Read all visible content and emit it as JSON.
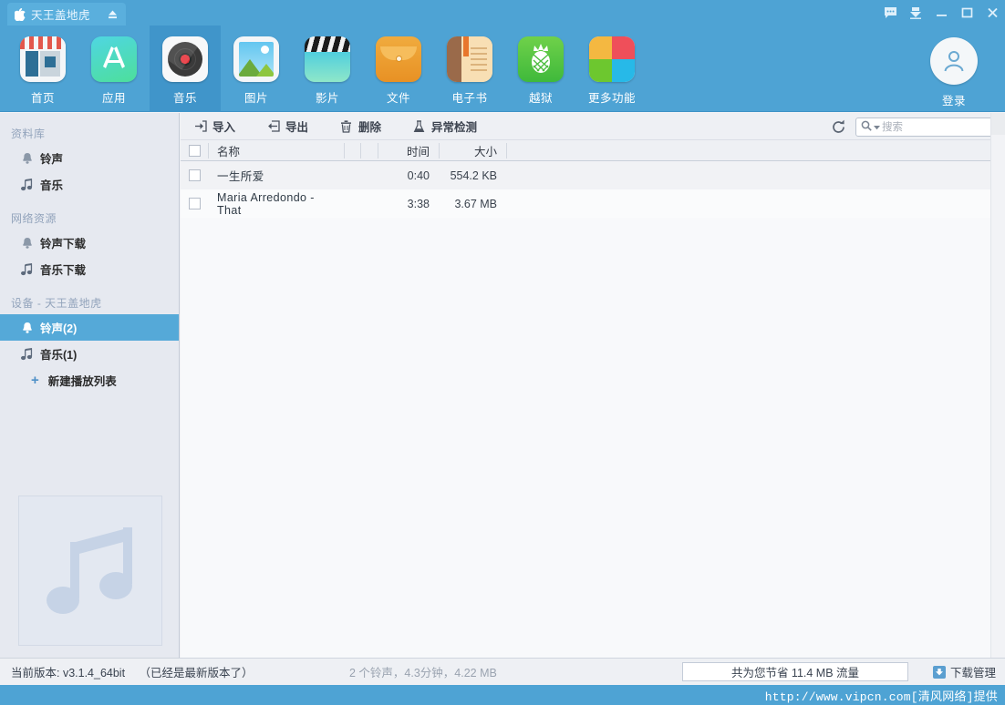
{
  "titlebar": {
    "device_name": "天王盖地虎",
    "apple_icon": "apple-icon",
    "eject_icon": "eject-icon",
    "window_buttons": [
      {
        "name": "message-icon",
        "label": "message"
      },
      {
        "name": "download-icon",
        "label": "download"
      },
      {
        "name": "minimize-icon",
        "label": "minimize"
      },
      {
        "name": "maximize-icon",
        "label": "maximize"
      },
      {
        "name": "close-icon",
        "label": "close"
      }
    ]
  },
  "navbar": {
    "items": [
      {
        "label": "首页",
        "icon": "store-icon",
        "active": false
      },
      {
        "label": "应用",
        "icon": "appstore-icon",
        "active": false
      },
      {
        "label": "音乐",
        "icon": "vinyl-record-icon",
        "active": true
      },
      {
        "label": "图片",
        "icon": "photo-icon",
        "active": false
      },
      {
        "label": "影片",
        "icon": "clapperboard-icon",
        "active": false
      },
      {
        "label": "文件",
        "icon": "envelope-icon",
        "active": false
      },
      {
        "label": "电子书",
        "icon": "book-icon",
        "active": false
      },
      {
        "label": "越狱",
        "icon": "pineapple-icon",
        "active": false
      },
      {
        "label": "更多功能",
        "icon": "grid-four-color-icon",
        "active": false
      }
    ],
    "login": {
      "label": "登录",
      "icon": "user-avatar-icon"
    }
  },
  "sidebar": {
    "groups": [
      {
        "title": "资料库",
        "items": [
          {
            "label": "铃声",
            "icon": "bell-icon",
            "selected": false
          },
          {
            "label": "音乐",
            "icon": "music-note-icon",
            "selected": false
          }
        ]
      },
      {
        "title": "网络资源",
        "items": [
          {
            "label": "铃声下载",
            "icon": "bell-icon",
            "selected": false
          },
          {
            "label": "音乐下载",
            "icon": "music-note-icon",
            "selected": false
          }
        ]
      },
      {
        "title": "设备 - 天王盖地虎",
        "items": [
          {
            "label": "铃声(2)",
            "icon": "bell-icon",
            "selected": true
          },
          {
            "label": "音乐(1)",
            "icon": "music-note-icon",
            "selected": false
          },
          {
            "label": "新建播放列表",
            "icon": "plus-icon",
            "selected": false
          }
        ]
      }
    ],
    "album_art_icon": "music-note-placeholder-icon"
  },
  "actionbar": {
    "actions": [
      {
        "label": "导入",
        "icon": "import-icon"
      },
      {
        "label": "导出",
        "icon": "export-icon"
      },
      {
        "label": "删除",
        "icon": "trash-icon"
      },
      {
        "label": "异常检测",
        "icon": "flask-icon"
      }
    ],
    "refresh_icon": "refresh-icon",
    "search": {
      "placeholder": "搜索",
      "value": "",
      "icon": "search-icon",
      "dropdown_icon": "caret-down-icon"
    }
  },
  "table": {
    "columns": [
      "名称",
      "",
      "",
      "时间",
      "大小"
    ],
    "rows": [
      {
        "checked": false,
        "name": "一生所爱",
        "time": "0:40",
        "size": "554.2 KB"
      },
      {
        "checked": false,
        "name": "Maria Arredondo - That",
        "time": "3:38",
        "size": "3.67 MB"
      }
    ]
  },
  "statusbar": {
    "version": "当前版本: v3.1.4_64bit",
    "version_note": "（已经是最新版本了）",
    "summary": "2 个铃声，4.3分钟，4.22 MB",
    "saved_traffic": "共为您节省 11.4 MB 流量",
    "download_manager": "下载管理",
    "download_icon": "download-arrow-icon"
  },
  "watermark": "http://www.vipcn.com[清风网络]提供",
  "colors": {
    "brand_blue": "#4ea3d4",
    "active_tab": "#4095ca",
    "sidebar_bg": "#e6e9f0",
    "selection_blue": "#55a9d8",
    "row_odd": "#f1f2f5",
    "row_even": "#fafbfc"
  }
}
